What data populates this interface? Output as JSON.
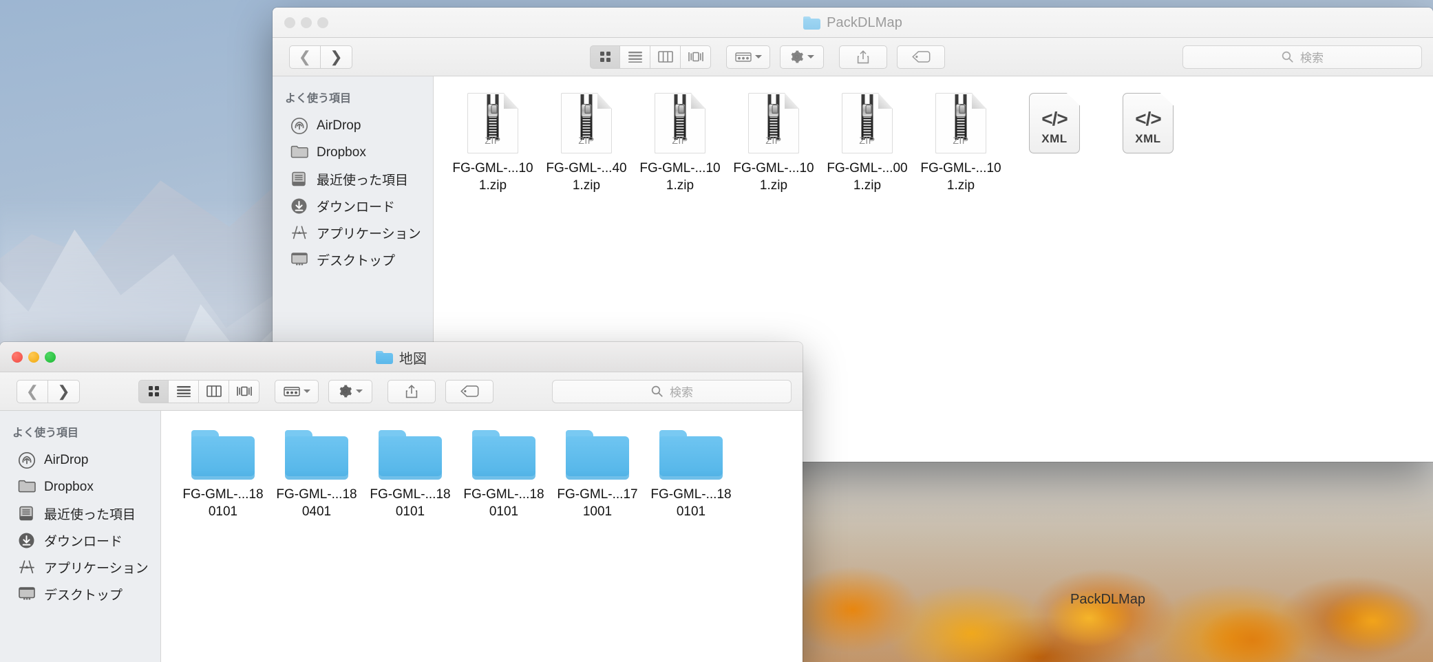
{
  "desktop": {
    "visible_folder_label": "PackDLMap"
  },
  "windows": {
    "back": {
      "title": "PackDLMap",
      "title_icon": "folder-icon",
      "active": false,
      "toolbar": {
        "back_label": "‹",
        "forward_label": "›",
        "view_icon_label": "icon-view",
        "view_list_label": "list-view",
        "view_column_label": "column-view",
        "view_coverflow_label": "coverflow-view",
        "arrange_label": "arrange-menu",
        "action_label": "action-menu",
        "share_label": "share-button",
        "tag_label": "tag-button"
      },
      "search": {
        "placeholder": "検索"
      },
      "sidebar": {
        "header": "よく使う項目",
        "items": [
          {
            "label": "AirDrop",
            "icon": "airdrop-icon"
          },
          {
            "label": "Dropbox",
            "icon": "folder-icon"
          },
          {
            "label": "最近使った項目",
            "icon": "recents-icon"
          },
          {
            "label": "ダウンロード",
            "icon": "downloads-icon"
          },
          {
            "label": "アプリケーション",
            "icon": "applications-icon"
          },
          {
            "label": "デスクトップ",
            "icon": "desktop-icon"
          }
        ]
      },
      "items": [
        {
          "name": "FG-GML-...101.zip",
          "kind": "ZIP",
          "icon": "zip-file-icon"
        },
        {
          "name": "FG-GML-...401.zip",
          "kind": "ZIP",
          "icon": "zip-file-icon"
        },
        {
          "name": "FG-GML-...101.zip",
          "kind": "ZIP",
          "icon": "zip-file-icon"
        },
        {
          "name": "FG-GML-...101.zip",
          "kind": "ZIP",
          "icon": "zip-file-icon"
        },
        {
          "name": "FG-GML-...001.zip",
          "kind": "ZIP",
          "icon": "zip-file-icon"
        },
        {
          "name": "FG-GML-...101.zip",
          "kind": "ZIP",
          "icon": "zip-file-icon"
        },
        {
          "name": "",
          "kind": "XML",
          "icon": "xml-file-icon"
        },
        {
          "name": "",
          "kind": "XML",
          "icon": "xml-file-icon"
        }
      ]
    },
    "front": {
      "title": "地図",
      "title_icon": "folder-icon",
      "active": true,
      "toolbar": {
        "back_label": "‹",
        "forward_label": "›",
        "view_icon_label": "icon-view",
        "view_list_label": "list-view",
        "view_column_label": "column-view",
        "view_coverflow_label": "coverflow-view",
        "arrange_label": "arrange-menu",
        "action_label": "action-menu",
        "share_label": "share-button",
        "tag_label": "tag-button"
      },
      "search": {
        "placeholder": "検索"
      },
      "sidebar": {
        "header": "よく使う項目",
        "items": [
          {
            "label": "AirDrop",
            "icon": "airdrop-icon"
          },
          {
            "label": "Dropbox",
            "icon": "folder-icon"
          },
          {
            "label": "最近使った項目",
            "icon": "recents-icon"
          },
          {
            "label": "ダウンロード",
            "icon": "downloads-icon"
          },
          {
            "label": "アプリケーション",
            "icon": "applications-icon"
          },
          {
            "label": "デスクトップ",
            "icon": "desktop-icon"
          }
        ]
      },
      "items": [
        {
          "name": "FG-GML-...180101",
          "icon": "folder-icon"
        },
        {
          "name": "FG-GML-...180401",
          "icon": "folder-icon"
        },
        {
          "name": "FG-GML-...180101",
          "icon": "folder-icon"
        },
        {
          "name": "FG-GML-...180101",
          "icon": "folder-icon"
        },
        {
          "name": "FG-GML-...171001",
          "icon": "folder-icon"
        },
        {
          "name": "FG-GML-...180101",
          "icon": "folder-icon"
        }
      ]
    }
  },
  "colors": {
    "folder_blue": "#5bb8ea",
    "close_red": "#f04a41",
    "min_yellow": "#f0a90e",
    "zoom_green": "#1db934",
    "inactive_gray": "#dcdcdc"
  }
}
